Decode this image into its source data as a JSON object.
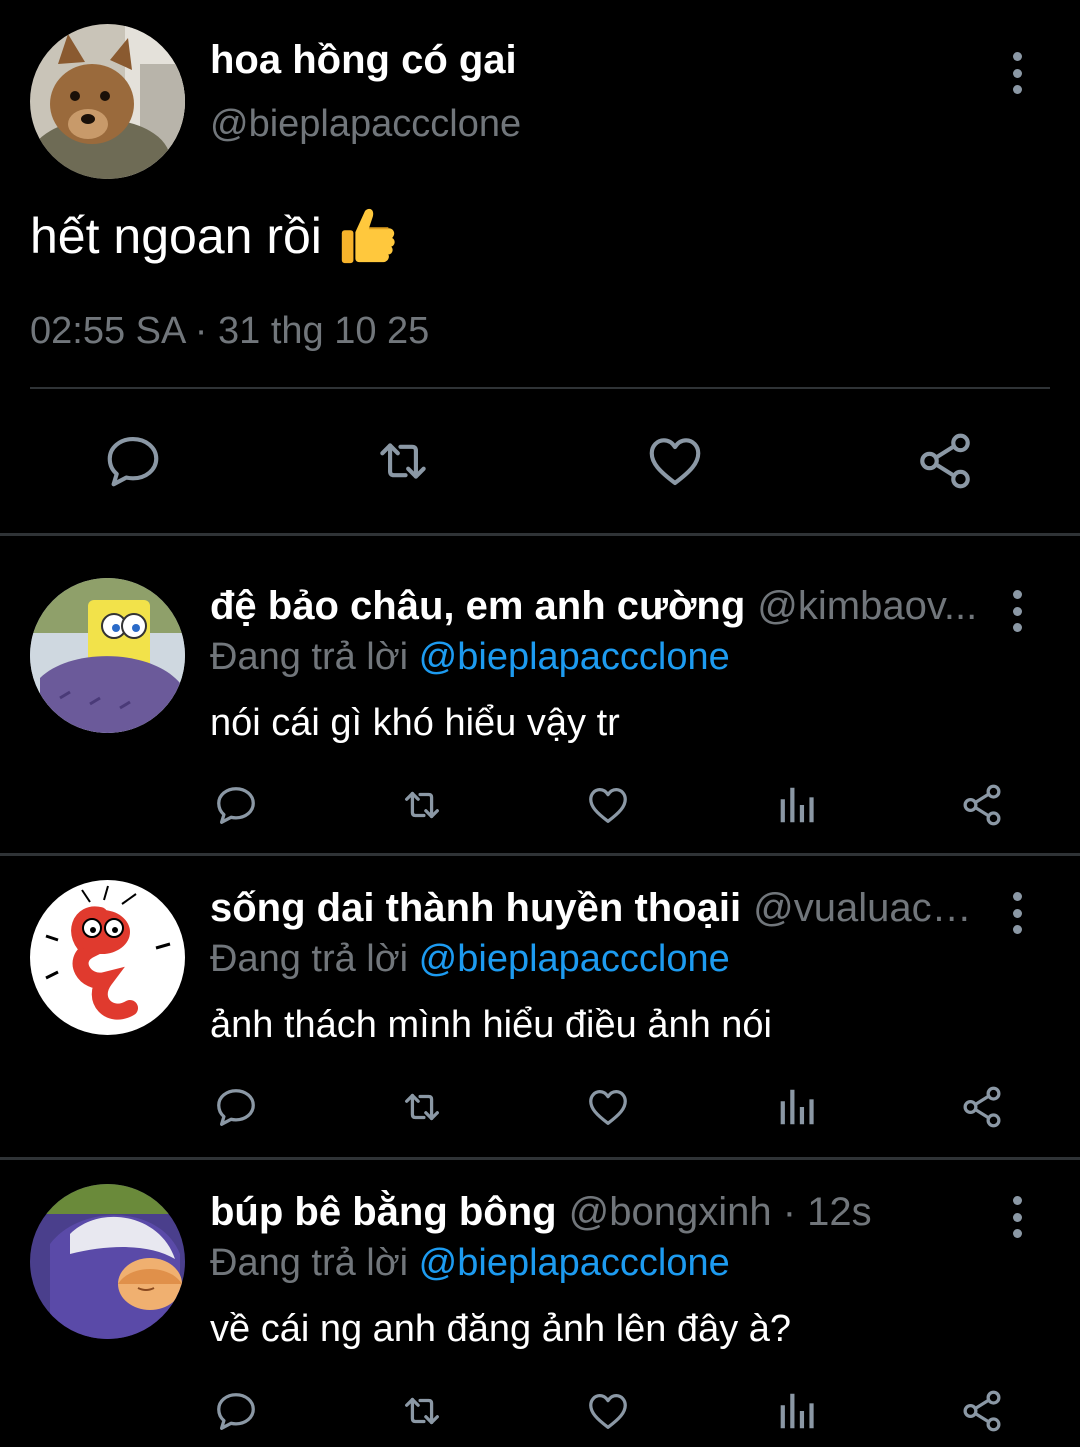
{
  "main_tweet": {
    "author_name": "hoa hồng có gai",
    "handle": "@bieplapaccclone",
    "text": "hết ngoan rồi",
    "emoji": "👍",
    "timestamp": "02:55 SA · 31 thg 10 25",
    "actions": [
      "reply-icon",
      "retweet-icon",
      "like-icon",
      "share-icon"
    ]
  },
  "replies": [
    {
      "author_name": "đệ bảo châu, em anh cường",
      "handle": "@kimbaov...",
      "replying_label": "Đang trả lời",
      "replying_to": "@bieplapaccclone",
      "text": "nói cái gì khó hiểu vậy tr"
    },
    {
      "author_name": "sống dai thành huyền thoạii",
      "handle": "@vualuach...",
      "replying_label": "Đang trả lời",
      "replying_to": "@bieplapaccclone",
      "text": "ảnh thách mình hiểu điều ảnh nói"
    },
    {
      "author_name": "búp bê bằng bông",
      "handle": "@bongxinh · 12s",
      "replying_label": "Đang trả lời",
      "replying_to": "@bieplapaccclone",
      "text": "về cái ng anh đăng ảnh lên đây à?"
    }
  ],
  "colors": {
    "background": "#000000",
    "text": "#ffffff",
    "secondary": "#71767b",
    "mention": "#1d9bf0",
    "divider": "#2f3336",
    "icon": "#8b98a5"
  }
}
